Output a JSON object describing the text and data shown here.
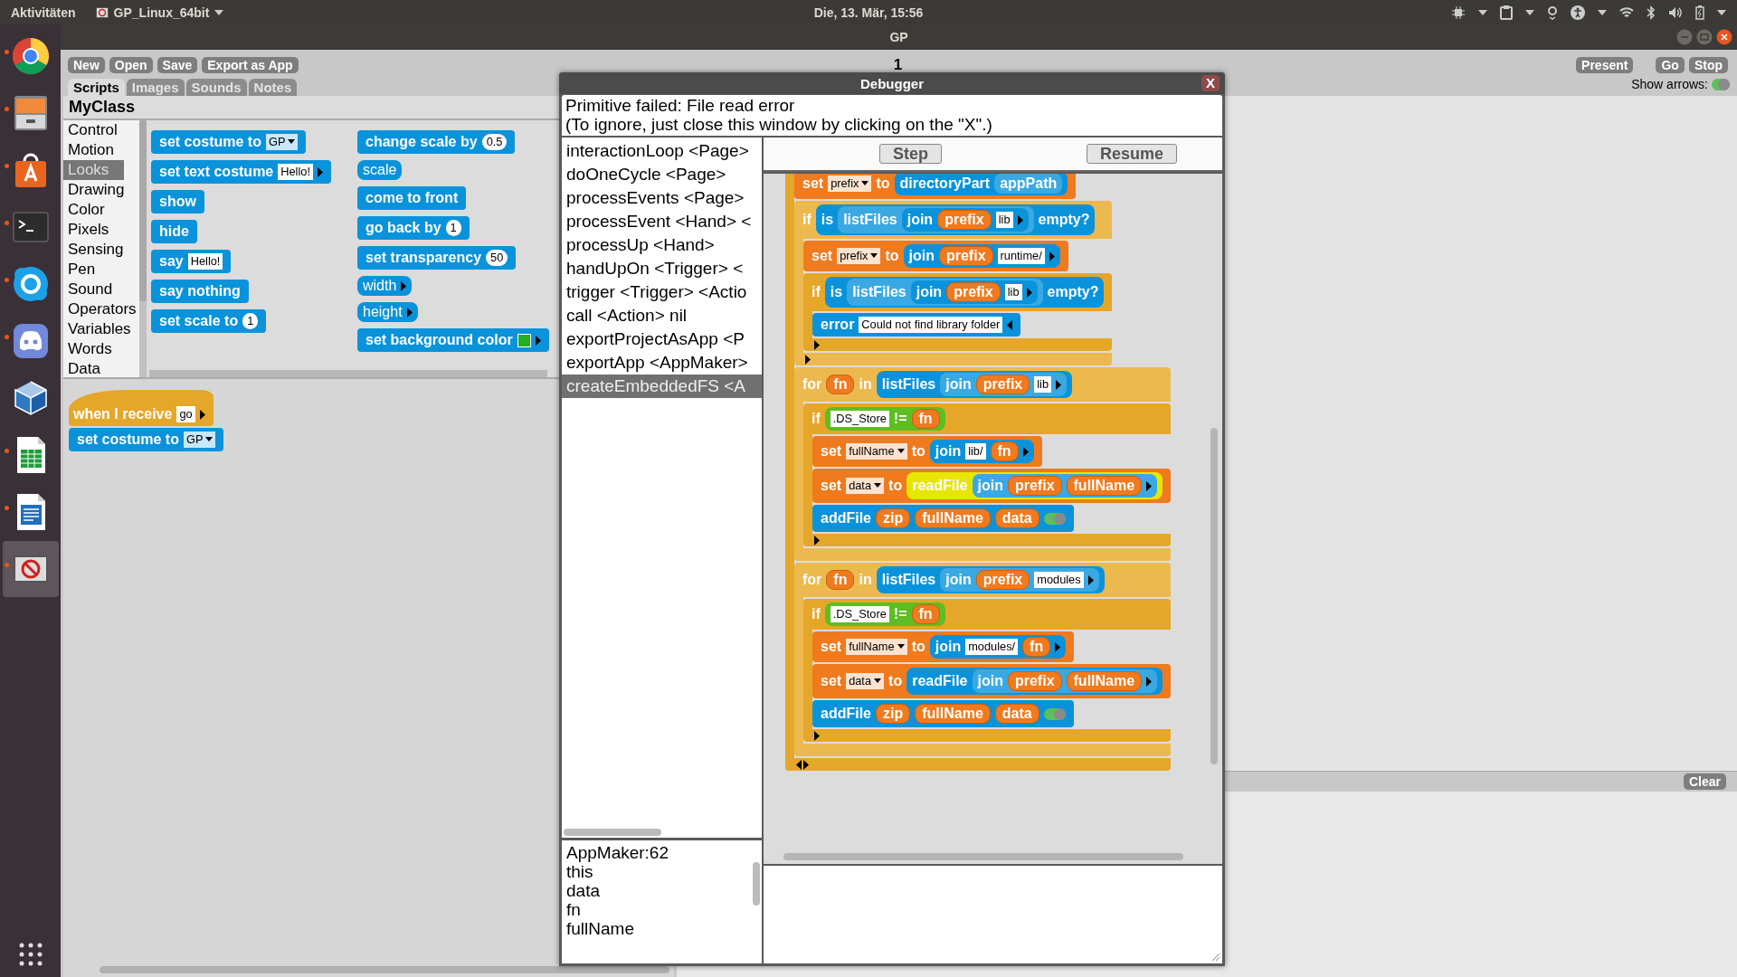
{
  "top_bar": {
    "activities": "Aktivitäten",
    "app_menu": "GP_Linux_64bit",
    "clock": "Die, 13. Mär, 15:56"
  },
  "dock": {
    "items": [
      {
        "kind": "browser",
        "running": true,
        "selected": false
      },
      {
        "kind": "files",
        "running": true,
        "selected": false
      },
      {
        "kind": "software",
        "running": true,
        "selected": false
      },
      {
        "kind": "terminal",
        "running": true,
        "selected": false
      },
      {
        "kind": "chat",
        "running": true,
        "selected": false
      },
      {
        "kind": "voice",
        "running": true,
        "selected": false
      },
      {
        "kind": "virtualbox",
        "running": false,
        "selected": false
      },
      {
        "kind": "spreadsheet",
        "running": true,
        "selected": false
      },
      {
        "kind": "writer",
        "running": true,
        "selected": false
      },
      {
        "kind": "gp",
        "running": true,
        "selected": true
      }
    ]
  },
  "window": {
    "title": "GP"
  },
  "toolbar": {
    "buttons": [
      "New",
      "Open",
      "Save",
      "Export as App"
    ],
    "page": "1",
    "right_buttons": [
      "Present",
      "Go",
      "Stop"
    ],
    "show_arrows": {
      "label": "Show arrows:",
      "on": true
    }
  },
  "tabs": [
    {
      "label": "Scripts",
      "selected": true
    },
    {
      "label": "Images",
      "selected": false
    },
    {
      "label": "Sounds",
      "selected": false
    },
    {
      "label": "Notes",
      "selected": false
    }
  ],
  "class_pane": {
    "title": "MyClass",
    "categories": [
      {
        "label": "Control",
        "selected": false
      },
      {
        "label": "Motion",
        "selected": false
      },
      {
        "label": "Looks",
        "selected": true
      },
      {
        "label": "Drawing",
        "selected": false
      },
      {
        "label": "Color",
        "selected": false
      },
      {
        "label": "Pixels",
        "selected": false
      },
      {
        "label": "Sensing",
        "selected": false
      },
      {
        "label": "Pen",
        "selected": false
      },
      {
        "label": "Sound",
        "selected": false
      },
      {
        "label": "Operators",
        "selected": false
      },
      {
        "label": "Variables",
        "selected": false
      },
      {
        "label": "Words",
        "selected": false
      },
      {
        "label": "Data",
        "selected": false
      }
    ],
    "palette": [
      [
        {
          "kind": "command",
          "color": "#0a93db",
          "parts": [
            {
              "kind": "label",
              "text": "set costume to"
            },
            {
              "kind": "menu",
              "text": "GP"
            }
          ]
        },
        {
          "kind": "command",
          "color": "#0a93db",
          "parts": [
            {
              "kind": "label",
              "text": "set text costume"
            },
            {
              "kind": "text",
              "text": "Hello!"
            },
            {
              "kind": "expand"
            }
          ]
        },
        {
          "kind": "command",
          "color": "#0a93db",
          "parts": [
            {
              "kind": "label",
              "text": "show"
            }
          ]
        },
        {
          "kind": "command",
          "color": "#0a93db",
          "parts": [
            {
              "kind": "label",
              "text": "hide"
            }
          ]
        },
        {
          "kind": "command",
          "color": "#0a93db",
          "parts": [
            {
              "kind": "label",
              "text": "say"
            },
            {
              "kind": "text",
              "text": "Hello!"
            }
          ]
        },
        {
          "kind": "command",
          "color": "#0a93db",
          "parts": [
            {
              "kind": "label",
              "text": "say nothing"
            }
          ]
        },
        {
          "kind": "command",
          "color": "#0a93db",
          "parts": [
            {
              "kind": "label",
              "text": "set scale to"
            },
            {
              "kind": "number",
              "text": "1"
            }
          ]
        }
      ],
      [
        {
          "kind": "command",
          "color": "#0a93db",
          "parts": [
            {
              "kind": "label",
              "text": "change scale by"
            },
            {
              "kind": "number",
              "text": "0.5"
            }
          ]
        },
        {
          "kind": "reporter",
          "color": "#0a93db",
          "parts": [
            {
              "kind": "label",
              "text": "scale"
            }
          ]
        },
        {
          "kind": "command",
          "color": "#0a93db",
          "parts": [
            {
              "kind": "label",
              "text": "come to front"
            }
          ]
        },
        {
          "kind": "command",
          "color": "#0a93db",
          "parts": [
            {
              "kind": "label",
              "text": "go back by"
            },
            {
              "kind": "number",
              "text": "1"
            }
          ]
        },
        {
          "kind": "command",
          "color": "#0a93db",
          "parts": [
            {
              "kind": "label",
              "text": "set transparency"
            },
            {
              "kind": "number",
              "text": "50"
            }
          ]
        },
        {
          "kind": "reporter",
          "color": "#0a93db",
          "parts": [
            {
              "kind": "label",
              "text": "width"
            },
            {
              "kind": "expand"
            }
          ]
        },
        {
          "kind": "reporter",
          "color": "#0a93db",
          "parts": [
            {
              "kind": "label",
              "text": "height"
            },
            {
              "kind": "expand"
            }
          ]
        },
        {
          "kind": "command",
          "color": "#0a93db",
          "parts": [
            {
              "kind": "label",
              "text": "set background color"
            },
            {
              "kind": "swatch"
            },
            {
              "kind": "expand"
            }
          ]
        }
      ]
    ],
    "scripts": [
      {
        "kind": "hat",
        "color": "#e5a72a",
        "parts": [
          {
            "kind": "label",
            "text": "when I receive"
          },
          {
            "kind": "text",
            "text": "go"
          },
          {
            "kind": "expand"
          }
        ]
      },
      {
        "kind": "command",
        "color": "#0a93db",
        "parts": [
          {
            "kind": "label",
            "text": "set costume to"
          },
          {
            "kind": "menu",
            "text": "GP"
          }
        ]
      }
    ]
  },
  "output": {
    "clear": "Clear"
  },
  "debugger": {
    "title": "Debugger",
    "close": "X",
    "message": [
      "Primitive failed: File read error",
      "(To ignore, just close this window by clicking on the \"X\".)"
    ],
    "stack": [
      {
        "text": "interactionLoop <Page>",
        "selected": false
      },
      {
        "text": "doOneCycle <Page>",
        "selected": false
      },
      {
        "text": "processEvents <Page>",
        "selected": false
      },
      {
        "text": "processEvent <Hand> <",
        "selected": false
      },
      {
        "text": "processUp <Hand>",
        "selected": false
      },
      {
        "text": "handUpOn <Trigger> <",
        "selected": false
      },
      {
        "text": "trigger <Trigger> <Actio",
        "selected": false
      },
      {
        "text": "call <Action> nil",
        "selected": false
      },
      {
        "text": "exportProjectAsApp <P",
        "selected": false
      },
      {
        "text": "exportApp <AppMaker>",
        "selected": false
      },
      {
        "text": "createEmbeddedFS <A",
        "selected": true
      }
    ],
    "buttons": [
      "Step",
      "Resume"
    ],
    "variables": [
      "AppMaker:62",
      "this",
      "data",
      "fn",
      "fullName"
    ],
    "script": {
      "kind": "c-block",
      "color": "#e5a72a",
      "footer": [
        {
          "kind": "collapse"
        },
        {
          "kind": "expand"
        }
      ],
      "children": [
        {
          "kind": "command",
          "color": "#f07a1e",
          "parts": [
            {
              "kind": "label",
              "text": "set"
            },
            {
              "kind": "menu",
              "text": "prefix"
            },
            {
              "kind": "label",
              "text": "to"
            },
            {
              "kind": "reporter",
              "color": "#0a93db",
              "parts": [
                {
                  "kind": "label",
                  "text": "directoryPart"
                },
                {
                  "kind": "reporter",
                  "color": "#3aa9e3",
                  "parts": [
                    {
                      "kind": "label",
                      "text": "appPath"
                    }
                  ]
                }
              ]
            }
          ]
        },
        {
          "kind": "c-block",
          "color": "#ecb94e",
          "footer": [
            {
              "kind": "expand"
            }
          ],
          "parts": [
            {
              "kind": "label",
              "text": "if"
            },
            {
              "kind": "reporter",
              "color": "#0a93db",
              "parts": [
                {
                  "kind": "label",
                  "text": "is"
                },
                {
                  "kind": "reporter",
                  "color": "#3aa9e3",
                  "parts": [
                    {
                      "kind": "label",
                      "text": "listFiles"
                    },
                    {
                      "kind": "reporter",
                      "color": "#0a93db",
                      "parts": [
                        {
                          "kind": "label",
                          "text": "join"
                        },
                        {
                          "kind": "var",
                          "text": "prefix"
                        },
                        {
                          "kind": "text",
                          "text": "lib"
                        },
                        {
                          "kind": "expand"
                        }
                      ]
                    }
                  ]
                },
                {
                  "kind": "label",
                  "text": "empty?"
                }
              ]
            }
          ],
          "children": [
            {
              "kind": "command",
              "color": "#f07a1e",
              "parts": [
                {
                  "kind": "label",
                  "text": "set"
                },
                {
                  "kind": "menu",
                  "text": "prefix"
                },
                {
                  "kind": "label",
                  "text": "to"
                },
                {
                  "kind": "reporter",
                  "color": "#0a93db",
                  "parts": [
                    {
                      "kind": "label",
                      "text": "join"
                    },
                    {
                      "kind": "var",
                      "text": "prefix"
                    },
                    {
                      "kind": "text",
                      "text": "runtime/"
                    },
                    {
                      "kind": "expand"
                    }
                  ]
                }
              ]
            },
            {
              "kind": "c-block",
              "color": "#e5a72a",
              "footer": [
                {
                  "kind": "expand"
                }
              ],
              "parts": [
                {
                  "kind": "label",
                  "text": "if"
                },
                {
                  "kind": "reporter",
                  "color": "#0a93db",
                  "parts": [
                    {
                      "kind": "label",
                      "text": "is"
                    },
                    {
                      "kind": "reporter",
                      "color": "#3aa9e3",
                      "parts": [
                        {
                          "kind": "label",
                          "text": "listFiles"
                        },
                        {
                          "kind": "reporter",
                          "color": "#0a93db",
                          "parts": [
                            {
                              "kind": "label",
                              "text": "join"
                            },
                            {
                              "kind": "var",
                              "text": "prefix"
                            },
                            {
                              "kind": "text",
                              "text": "lib"
                            },
                            {
                              "kind": "expand"
                            }
                          ]
                        }
                      ]
                    },
                    {
                      "kind": "label",
                      "text": "empty?"
                    }
                  ]
                }
              ],
              "children": [
                {
                  "kind": "command",
                  "color": "#0a93db",
                  "parts": [
                    {
                      "kind": "label",
                      "text": "error"
                    },
                    {
                      "kind": "text",
                      "text": "Could not find library folder"
                    },
                    {
                      "kind": "collapse"
                    }
                  ]
                }
              ]
            }
          ]
        },
        {
          "kind": "c-block",
          "color": "#ecb94e",
          "parts": [
            {
              "kind": "label",
              "text": "for"
            },
            {
              "kind": "var",
              "text": "fn"
            },
            {
              "kind": "label",
              "text": "in"
            },
            {
              "kind": "reporter",
              "color": "#0a93db",
              "parts": [
                {
                  "kind": "label",
                  "text": "listFiles"
                },
                {
                  "kind": "reporter",
                  "color": "#3aa9e3",
                  "parts": [
                    {
                      "kind": "label",
                      "text": "join"
                    },
                    {
                      "kind": "var",
                      "text": "prefix"
                    },
                    {
                      "kind": "text",
                      "text": "lib"
                    },
                    {
                      "kind": "expand"
                    }
                  ]
                }
              ]
            }
          ],
          "children": [
            {
              "kind": "c-block",
              "color": "#e5a72a",
              "footer": [
                {
                  "kind": "expand"
                }
              ],
              "parts": [
                {
                  "kind": "label",
                  "text": "if"
                },
                {
                  "kind": "reporter",
                  "color": "#5cbe22",
                  "parts": [
                    {
                      "kind": "text",
                      "text": ".DS_Store"
                    },
                    {
                      "kind": "label",
                      "text": "!="
                    },
                    {
                      "kind": "var",
                      "text": "fn"
                    }
                  ]
                }
              ],
              "children": [
                {
                  "kind": "command",
                  "color": "#f07a1e",
                  "parts": [
                    {
                      "kind": "label",
                      "text": "set"
                    },
                    {
                      "kind": "menu",
                      "text": "fullName"
                    },
                    {
                      "kind": "label",
                      "text": "to"
                    },
                    {
                      "kind": "reporter",
                      "color": "#0a93db",
                      "parts": [
                        {
                          "kind": "label",
                          "text": "join"
                        },
                        {
                          "kind": "text",
                          "text": "lib/"
                        },
                        {
                          "kind": "var",
                          "text": "fn"
                        },
                        {
                          "kind": "expand"
                        }
                      ]
                    }
                  ]
                },
                {
                  "kind": "command",
                  "color": "#f07a1e",
                  "parts": [
                    {
                      "kind": "label",
                      "text": "set"
                    },
                    {
                      "kind": "menu",
                      "text": "data"
                    },
                    {
                      "kind": "label",
                      "text": "to"
                    },
                    {
                      "kind": "reporter",
                      "color": "#e6e600",
                      "parts": [
                        {
                          "kind": "label",
                          "text": "readFile"
                        },
                        {
                          "kind": "reporter",
                          "color": "#3aa9e3",
                          "parts": [
                            {
                              "kind": "label",
                              "text": "join"
                            },
                            {
                              "kind": "var",
                              "text": "prefix"
                            },
                            {
                              "kind": "var",
                              "text": "fullName"
                            },
                            {
                              "kind": "expand"
                            }
                          ]
                        }
                      ]
                    }
                  ]
                },
                {
                  "kind": "command",
                  "color": "#0a93db",
                  "parts": [
                    {
                      "kind": "label",
                      "text": "addFile"
                    },
                    {
                      "kind": "var",
                      "text": "zip"
                    },
                    {
                      "kind": "var",
                      "text": "fullName"
                    },
                    {
                      "kind": "var",
                      "text": "data"
                    },
                    {
                      "kind": "toggle",
                      "on": true
                    }
                  ]
                }
              ]
            }
          ]
        },
        {
          "kind": "c-block",
          "color": "#ecb94e",
          "parts": [
            {
              "kind": "label",
              "text": "for"
            },
            {
              "kind": "var",
              "text": "fn"
            },
            {
              "kind": "label",
              "text": "in"
            },
            {
              "kind": "reporter",
              "color": "#0a93db",
              "parts": [
                {
                  "kind": "label",
                  "text": "listFiles"
                },
                {
                  "kind": "reporter",
                  "color": "#3aa9e3",
                  "parts": [
                    {
                      "kind": "label",
                      "text": "join"
                    },
                    {
                      "kind": "var",
                      "text": "prefix"
                    },
                    {
                      "kind": "text",
                      "text": "modules"
                    },
                    {
                      "kind": "expand"
                    }
                  ]
                }
              ]
            }
          ],
          "children": [
            {
              "kind": "c-block",
              "color": "#e5a72a",
              "footer": [
                {
                  "kind": "expand"
                }
              ],
              "parts": [
                {
                  "kind": "label",
                  "text": "if"
                },
                {
                  "kind": "reporter",
                  "color": "#5cbe22",
                  "parts": [
                    {
                      "kind": "text",
                      "text": ".DS_Store"
                    },
                    {
                      "kind": "label",
                      "text": "!="
                    },
                    {
                      "kind": "var",
                      "text": "fn"
                    }
                  ]
                }
              ],
              "children": [
                {
                  "kind": "command",
                  "color": "#f07a1e",
                  "parts": [
                    {
                      "kind": "label",
                      "text": "set"
                    },
                    {
                      "kind": "menu",
                      "text": "fullName"
                    },
                    {
                      "kind": "label",
                      "text": "to"
                    },
                    {
                      "kind": "reporter",
                      "color": "#0a93db",
                      "parts": [
                        {
                          "kind": "label",
                          "text": "join"
                        },
                        {
                          "kind": "text",
                          "text": "modules/"
                        },
                        {
                          "kind": "var",
                          "text": "fn"
                        },
                        {
                          "kind": "expand"
                        }
                      ]
                    }
                  ]
                },
                {
                  "kind": "command",
                  "color": "#f07a1e",
                  "parts": [
                    {
                      "kind": "label",
                      "text": "set"
                    },
                    {
                      "kind": "menu",
                      "text": "data"
                    },
                    {
                      "kind": "label",
                      "text": "to"
                    },
                    {
                      "kind": "reporter",
                      "color": "#0a93db",
                      "parts": [
                        {
                          "kind": "label",
                          "text": "readFile"
                        },
                        {
                          "kind": "reporter",
                          "color": "#3aa9e3",
                          "parts": [
                            {
                              "kind": "label",
                              "text": "join"
                            },
                            {
                              "kind": "var",
                              "text": "prefix"
                            },
                            {
                              "kind": "var",
                              "text": "fullName"
                            },
                            {
                              "kind": "expand"
                            }
                          ]
                        }
                      ]
                    }
                  ]
                },
                {
                  "kind": "command",
                  "color": "#0a93db",
                  "parts": [
                    {
                      "kind": "label",
                      "text": "addFile"
                    },
                    {
                      "kind": "var",
                      "text": "zip"
                    },
                    {
                      "kind": "var",
                      "text": "fullName"
                    },
                    {
                      "kind": "var",
                      "text": "data"
                    },
                    {
                      "kind": "toggle",
                      "on": true
                    }
                  ]
                }
              ]
            }
          ]
        }
      ]
    }
  }
}
